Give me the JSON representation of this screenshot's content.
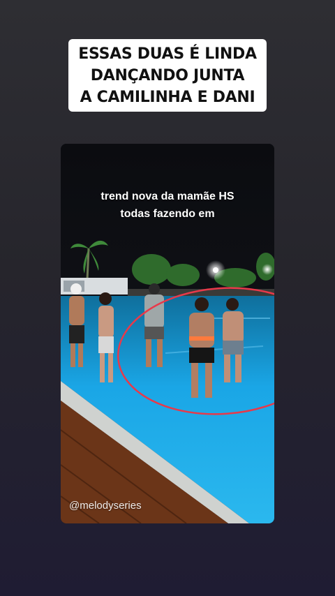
{
  "caption": {
    "lines": [
      "ESSAS DUAS É LINDA",
      "DANÇANDO JUNTA",
      "A CAMILINHA E DANI"
    ]
  },
  "video": {
    "overlay_lines": [
      "trend nova da mamãe HS",
      "todas fazendo em"
    ],
    "watermark": "@melodyseries"
  },
  "colors": {
    "caption_bg": "#ffffff",
    "caption_text": "#111111",
    "pool_water": "#1aa6e6",
    "highlight_circle": "#e8394a"
  }
}
